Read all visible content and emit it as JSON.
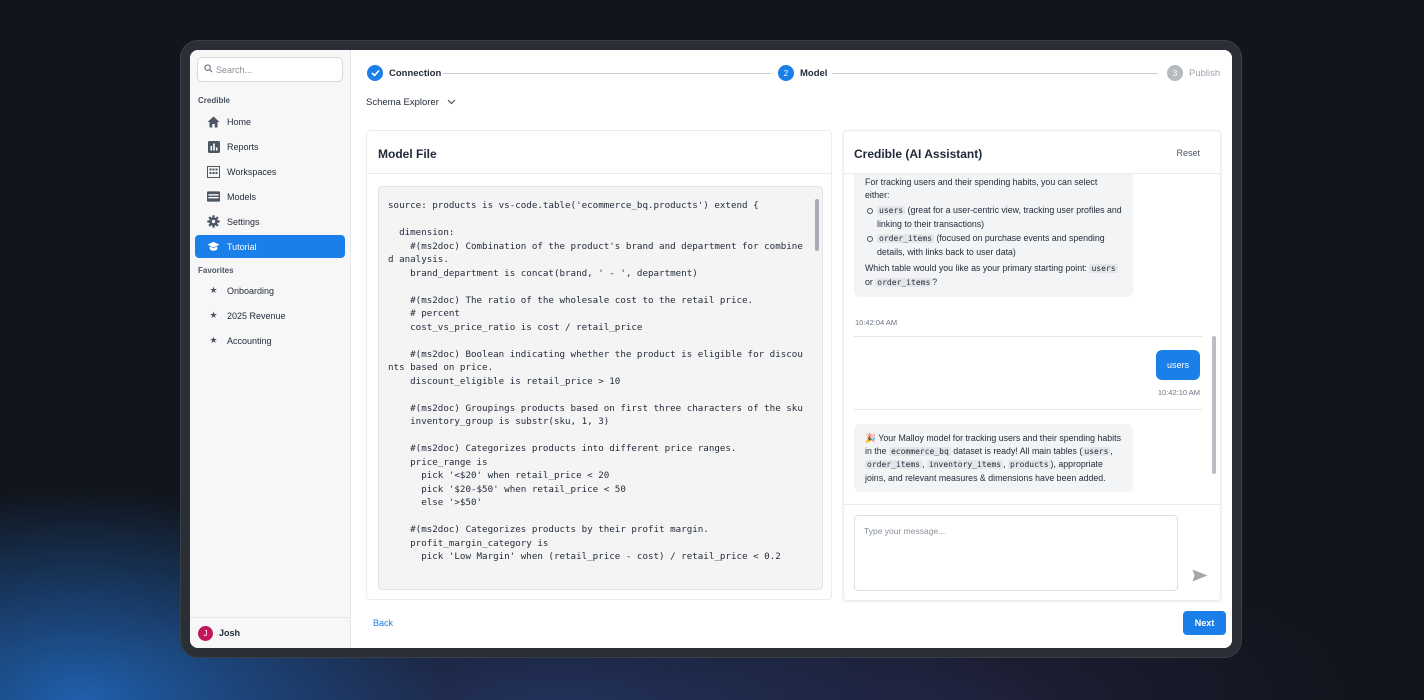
{
  "search": {
    "placeholder": "Search..."
  },
  "sidebar": {
    "section_title": "Credible",
    "items": [
      {
        "label": "Home",
        "icon": "home-icon"
      },
      {
        "label": "Reports",
        "icon": "bar-chart-icon"
      },
      {
        "label": "Workspaces",
        "icon": "building-icon"
      },
      {
        "label": "Models",
        "icon": "table-icon"
      },
      {
        "label": "Settings",
        "icon": "gear-icon"
      },
      {
        "label": "Tutorial",
        "icon": "graduation-cap-icon",
        "active": true
      }
    ],
    "favorites_title": "Favorites",
    "favorites": [
      {
        "label": "Onboarding",
        "icon": "star-icon"
      },
      {
        "label": "2025 Revenue",
        "icon": "star-icon"
      },
      {
        "label": "Accounting",
        "icon": "star-icon"
      }
    ],
    "user": {
      "name": "Josh",
      "initial": "J"
    }
  },
  "stepper": {
    "steps": [
      {
        "label": "Connection",
        "state": "complete"
      },
      {
        "label": "Model",
        "number": "2",
        "state": "active"
      },
      {
        "label": "Publish",
        "number": "3",
        "state": "pending"
      }
    ]
  },
  "schema_explorer": {
    "label": "Schema Explorer"
  },
  "model_file": {
    "title": "Model File",
    "code": "source: products is vs-code.table('ecommerce_bq.products') extend {\n\n  dimension:\n    #(ms2doc) Combination of the product's brand and department for combined analysis.\n    brand_department is concat(brand, ' - ', department)\n\n    #(ms2doc) The ratio of the wholesale cost to the retail price.\n    # percent\n    cost_vs_price_ratio is cost / retail_price\n\n    #(ms2doc) Boolean indicating whether the product is eligible for discounts based on price.\n    discount_eligible is retail_price > 10\n\n    #(ms2doc) Groupings products based on first three characters of the sku\n    inventory_group is substr(sku, 1, 3)\n\n    #(ms2doc) Categorizes products into different price ranges.\n    price_range is\n      pick '<$20' when retail_price < 20\n      pick '$20-$50' when retail_price < 50\n      else '>$50'\n\n    #(ms2doc) Categorizes products by their profit margin.\n    profit_margin_category is\n      pick 'Low Margin' when (retail_price - cost) / retail_price < 0.2"
  },
  "assistant": {
    "title": "Credible (AI Assistant)",
    "reset_label": "Reset",
    "message1": {
      "intro": "For tracking users and their spending habits, you can select either:",
      "options": [
        {
          "code": "users",
          "text": "(great for a user-centric view, tracking user profiles and linking to their transactions)"
        },
        {
          "code": "order_items",
          "text": "(focused on purchase events and spending details, with links back to user data)"
        }
      ],
      "question": "Which table would you like as your primary starting point:",
      "choice_a": "users",
      "or": "or",
      "choice_b": "order_items",
      "question_end": "?",
      "time": "10:42:04 AM"
    },
    "user_message": {
      "text": "users",
      "time": "10:42:10 AM"
    },
    "message2": {
      "emoji": "🎉",
      "t1": "Your Malloy model for tracking users and their spending habits in the",
      "dataset": "ecommerce_bq",
      "t2": "dataset is ready! All main tables (",
      "tables": [
        "users",
        "order_items",
        "inventory_items",
        "products"
      ],
      "t3": "), appropriate joins, and relevant measures & dimensions have been added."
    },
    "input_placeholder": "Type your message..."
  },
  "footer": {
    "back_label": "Back",
    "next_label": "Next"
  },
  "colors": {
    "accent": "#1a7fe8",
    "complete": "#1a7fe8",
    "pending": "#9ca3af"
  }
}
